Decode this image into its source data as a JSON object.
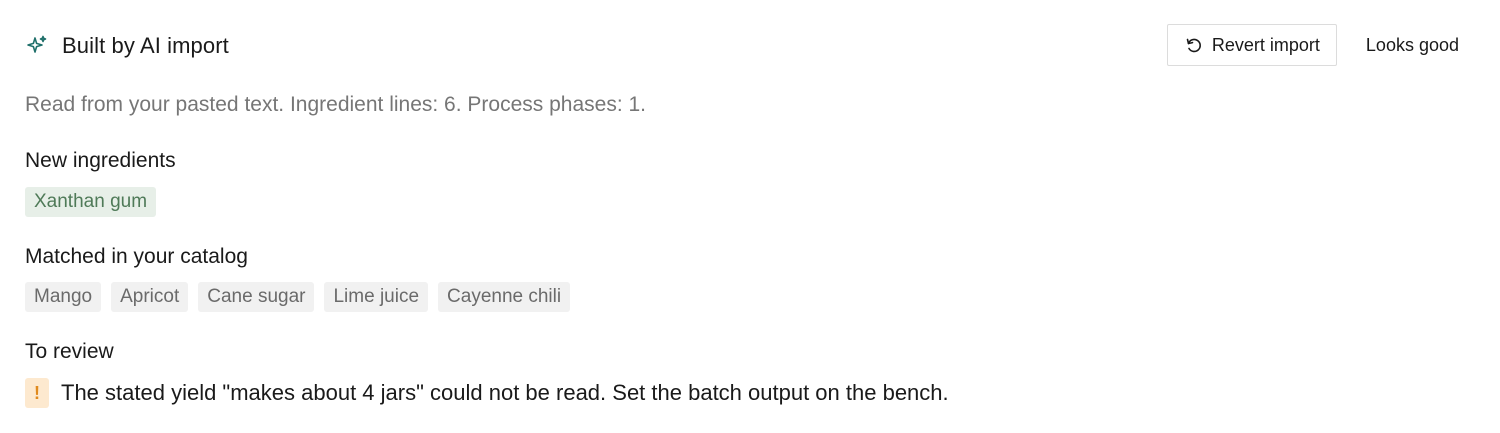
{
  "header": {
    "icon": "sparkle-icon",
    "title": "Built by AI import"
  },
  "actions": {
    "revert_label": "Revert import",
    "revert_icon": "undo-icon",
    "confirm_label": "Looks good"
  },
  "summary": "Read from your pasted text. Ingredient lines: 6. Process phases: 1.",
  "new_ingredients": {
    "title": "New ingredients",
    "items": [
      "Xanthan gum"
    ]
  },
  "matched": {
    "title": "Matched in your catalog",
    "items": [
      "Mango",
      "Apricot",
      "Cane sugar",
      "Lime juice",
      "Cayenne chili"
    ]
  },
  "review": {
    "title": "To review",
    "badge": "!",
    "items": [
      "The stated yield \"makes about 4 jars\" could not be read. Set the batch output on the bench."
    ]
  },
  "colors": {
    "accent_icon": "#1f6f6a",
    "new_chip_bg": "#e7efe8",
    "new_chip_text": "#4f7a58",
    "matched_chip_bg": "#f1f1f1",
    "warning_bg": "#fde9cf",
    "warning_text": "#e08a1e"
  }
}
